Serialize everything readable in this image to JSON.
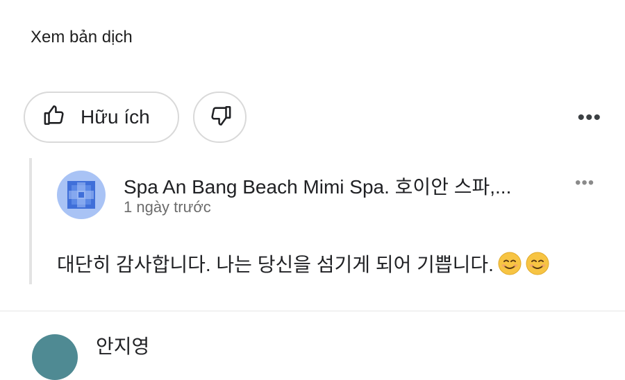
{
  "review": {
    "translate_link": "Xem bản dịch",
    "helpful_label": "Hữu ích",
    "actions": {
      "helpful_icon": "thumbs-up-icon",
      "unhelpful_icon": "thumbs-down-icon",
      "more_icon": "more-horizontal-icon"
    }
  },
  "owner_reply": {
    "name": "Spa An Bang Beach Mimi Spa. 호이안 스파,...",
    "time": "1 ngày trước",
    "text": "대단히 감사합니다. 나는 당신을 섬기게 되어 기쁩니다.",
    "emoji": [
      "smiling-face-emoji",
      "smiling-face-emoji"
    ],
    "avatar_color": "#a9c3f5",
    "more_icon": "more-horizontal-icon"
  },
  "next_review": {
    "name": "안지영",
    "avatar_color": "#4f8a93"
  }
}
